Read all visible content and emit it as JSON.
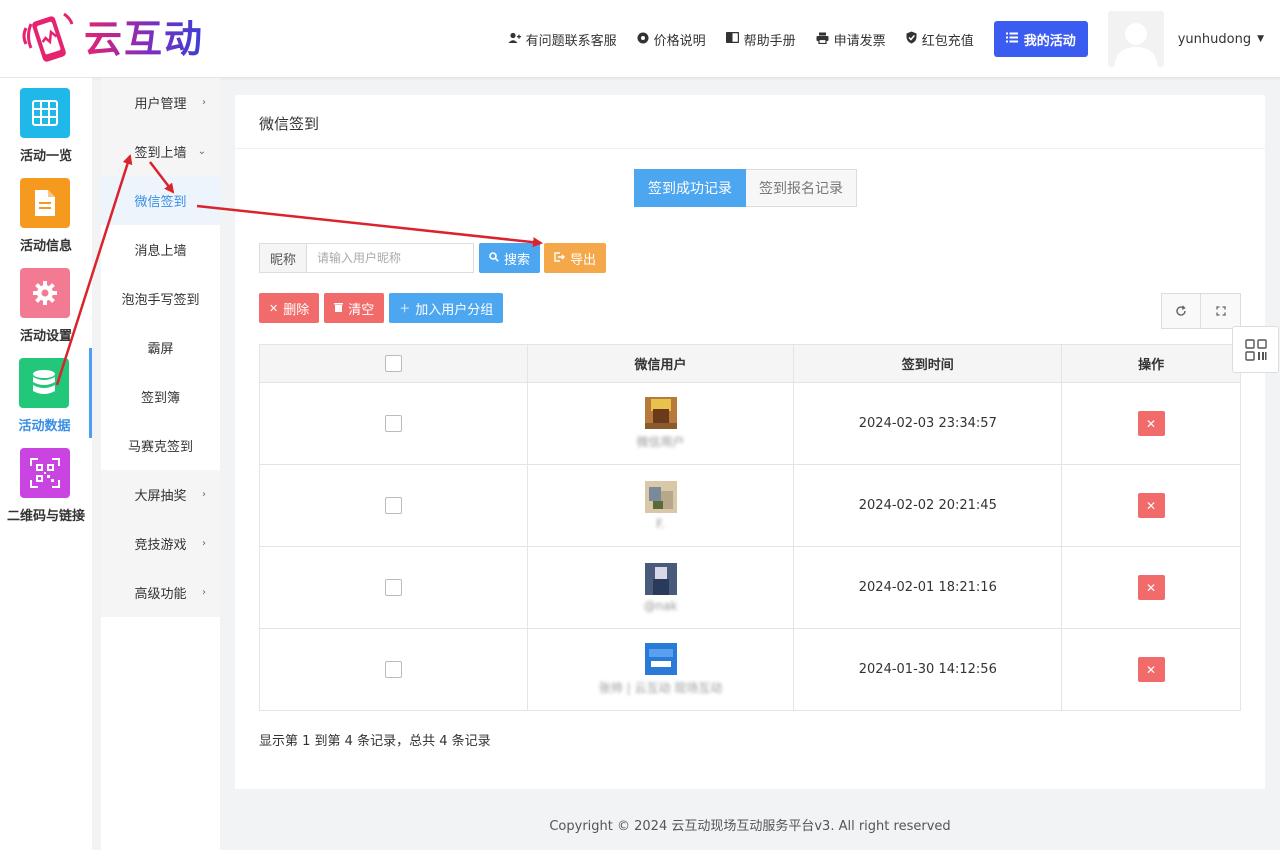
{
  "header": {
    "logo_text": "云互动",
    "nav": [
      {
        "label": "有问题联系客服",
        "icon": "user-plus-icon"
      },
      {
        "label": "价格说明",
        "icon": "gear-icon"
      },
      {
        "label": "帮助手册",
        "icon": "book-icon"
      },
      {
        "label": "申请发票",
        "icon": "printer-icon"
      },
      {
        "label": "红包充值",
        "icon": "shield-check-icon"
      }
    ],
    "my_activity": "我的活动",
    "username": "yunhudong"
  },
  "iconbar": [
    {
      "label": "活动一览",
      "icon": "grid-icon",
      "color": "#1fb8e8"
    },
    {
      "label": "活动信息",
      "icon": "document-icon",
      "color": "#f59a1f"
    },
    {
      "label": "活动设置",
      "icon": "gear-icon",
      "color": "#f27a93"
    },
    {
      "label": "活动数据",
      "icon": "database-icon",
      "color": "#22c77a",
      "active": true
    },
    {
      "label": "二维码与链接",
      "icon": "qrcode-icon",
      "color": "#c944e0"
    }
  ],
  "submenu": [
    {
      "label": "用户管理",
      "type": "parent",
      "arrow": "›"
    },
    {
      "label": "签到上墙",
      "type": "parent",
      "arrow": "⌄"
    },
    {
      "label": "微信签到",
      "type": "child",
      "active": true
    },
    {
      "label": "消息上墙",
      "type": "child"
    },
    {
      "label": "泡泡手写签到",
      "type": "child"
    },
    {
      "label": "霸屏",
      "type": "child"
    },
    {
      "label": "签到簿",
      "type": "child"
    },
    {
      "label": "马赛克签到",
      "type": "child"
    },
    {
      "label": "大屏抽奖",
      "type": "parent",
      "arrow": "›"
    },
    {
      "label": "竞技游戏",
      "type": "parent",
      "arrow": "›"
    },
    {
      "label": "高级功能",
      "type": "parent",
      "arrow": "›"
    }
  ],
  "panel": {
    "title": "微信签到",
    "tab_success": "签到成功记录",
    "tab_signup": "签到报名记录",
    "search_label": "昵称",
    "search_placeholder": "请输入用户昵称",
    "search_btn": "搜索",
    "export_btn": "导出",
    "delete_btn": "删除",
    "clear_btn": "清空",
    "add_group_btn": "加入用户分组",
    "columns": [
      "微信用户",
      "签到时间",
      "操作"
    ],
    "rows": [
      {
        "name": "微信用户",
        "time": "2024-02-03 23:34:57",
        "avatar_colors": [
          "#8a5a2a",
          "#e8c24a",
          "#6a3a1a"
        ]
      },
      {
        "name": "F.",
        "time": "2024-02-02 20:21:45",
        "avatar_colors": [
          "#b8a88a",
          "#7a8a9a",
          "#d8c8a8"
        ]
      },
      {
        "name": "@nak",
        "time": "2024-02-01 18:21:16",
        "avatar_colors": [
          "#2a3a5a",
          "#d8d8e8",
          "#4a5a7a"
        ]
      },
      {
        "name": "张帅 | 云互动 现场互动",
        "time": "2024-01-30 14:12:56",
        "avatar_colors": [
          "#2a7ad8",
          "#5aa0f0",
          "#ffffff"
        ]
      }
    ],
    "pager": "显示第 1 到第 4 条记录，总共 4 条记录"
  },
  "footer": "Copyright © 2024 云互动现场互动服务平台v3. All right reserved",
  "colors": {
    "accent": "#3a8ee6",
    "primary_btn": "#3b5cf0",
    "danger": "#f26b6b",
    "warning": "#f5a84a",
    "arrow": "#d9232d"
  }
}
